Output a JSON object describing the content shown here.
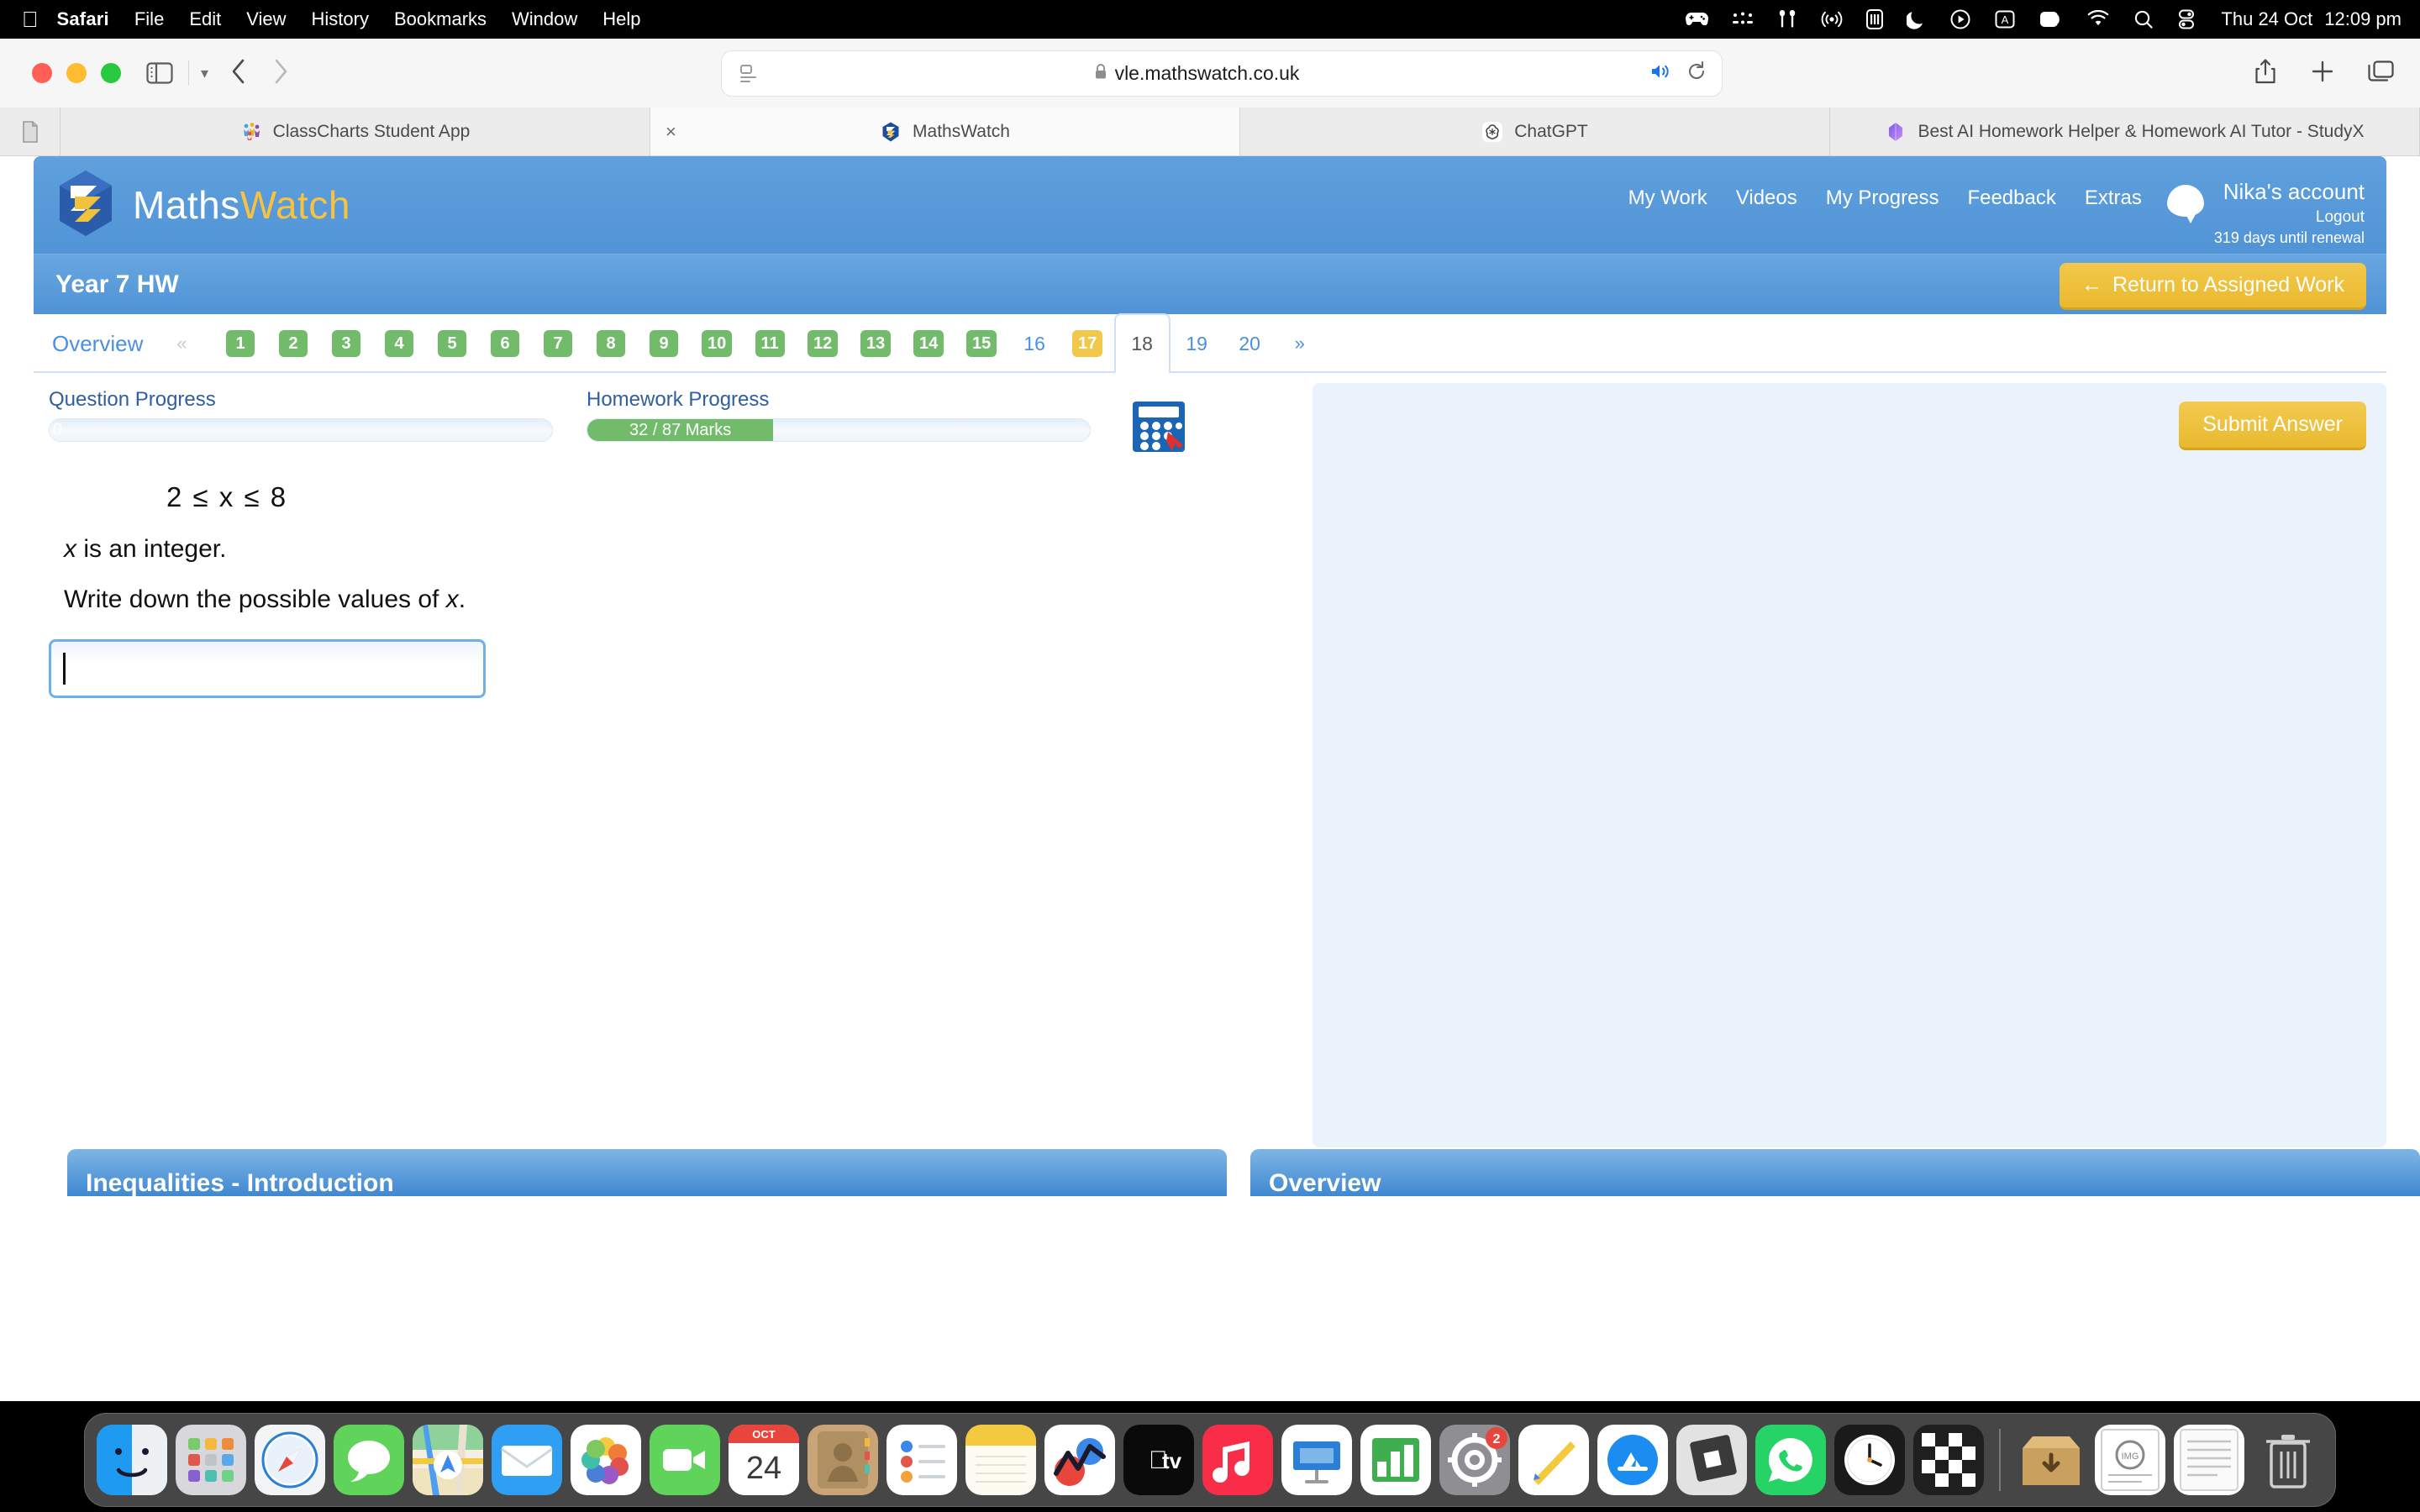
{
  "menubar": {
    "apple_icon": "apple-icon",
    "app_name": "Safari",
    "items": [
      "File",
      "Edit",
      "View",
      "History",
      "Bookmarks",
      "Window",
      "Help"
    ],
    "status_icons": [
      "game-controller-icon",
      "braille-dots-icon",
      "airpods-icon",
      "airplay-audio-icon",
      "battery-module-icon",
      "do-not-disturb-moon-icon",
      "now-playing-icon",
      "keyboard-input-a-icon",
      "screen-mirroring-icon",
      "wifi-icon",
      "spotlight-search-icon",
      "control-center-icon"
    ],
    "date": "Thu 24 Oct",
    "time": "12:09 pm"
  },
  "safari": {
    "toolbar": {
      "sidebar_icon": "sidebar-toggle-icon",
      "tab_overview_chevron": "chevron-down-icon",
      "back_icon": "back-chevron-icon",
      "forward_icon": "forward-chevron-icon",
      "reader_icon": "reader-view-icon",
      "lock_icon": "lock-icon",
      "url": "vle.mathswatch.co.uk",
      "audio_icon": "audio-playing-icon",
      "reload_icon": "reload-icon",
      "share_icon": "share-icon",
      "new_tab_icon": "plus-icon",
      "tab_group_icon": "tab-overview-icon"
    },
    "tabs": [
      {
        "label": "ClassCharts Student App",
        "favicon": "classcharts-icon",
        "active": false
      },
      {
        "label": "MathsWatch",
        "favicon": "mathswatch-icon",
        "active": true,
        "close": "×"
      },
      {
        "label": "ChatGPT",
        "favicon": "chatgpt-icon",
        "active": false
      },
      {
        "label": "Best AI Homework Helper & Homework AI Tutor - StudyX",
        "favicon": "studyx-icon",
        "active": false
      }
    ]
  },
  "site": {
    "brand": {
      "part1": "Maths",
      "part2": "Watch",
      "logo_icon": "mathswatch-logo-icon"
    },
    "nav": [
      "My Work",
      "Videos",
      "My Progress",
      "Feedback",
      "Extras"
    ],
    "account": {
      "avatar_icon": "speech-bubble-avatar-icon",
      "name": "Nika's account",
      "logout": "Logout",
      "renewal": "319 days until renewal"
    },
    "assignment": {
      "title": "Year 7 HW",
      "return_button": "Return to Assigned Work",
      "return_icon": "left-arrow-icon"
    },
    "question_nav": {
      "overview_label": "Overview",
      "prev_icon": "«",
      "next_icon": "»",
      "items": [
        {
          "n": "1",
          "state": "green"
        },
        {
          "n": "2",
          "state": "green"
        },
        {
          "n": "3",
          "state": "green"
        },
        {
          "n": "4",
          "state": "green"
        },
        {
          "n": "5",
          "state": "green"
        },
        {
          "n": "6",
          "state": "green"
        },
        {
          "n": "7",
          "state": "green"
        },
        {
          "n": "8",
          "state": "green"
        },
        {
          "n": "9",
          "state": "green"
        },
        {
          "n": "10",
          "state": "green"
        },
        {
          "n": "11",
          "state": "green"
        },
        {
          "n": "12",
          "state": "green"
        },
        {
          "n": "13",
          "state": "green"
        },
        {
          "n": "14",
          "state": "green"
        },
        {
          "n": "15",
          "state": "green"
        },
        {
          "n": "16",
          "state": "plain"
        },
        {
          "n": "17",
          "state": "amber"
        },
        {
          "n": "18",
          "state": "current"
        },
        {
          "n": "19",
          "state": "plain"
        },
        {
          "n": "20",
          "state": "plain"
        }
      ]
    },
    "progress": {
      "question": {
        "label": "Question Progress",
        "value_text": "0",
        "percent": 0
      },
      "homework": {
        "label": "Homework Progress",
        "value_text": "32 / 87 Marks",
        "percent": 37,
        "marks_earned": 32,
        "marks_total": 87
      }
    },
    "calculator_icon": "calculator-not-allowed-icon",
    "question": {
      "inequality": "2 ≤ x ≤ 8",
      "line1_pre": "x",
      "line1_post": " is an integer.",
      "line2_pre": "Write down the possible values of ",
      "line2_var": "x",
      "line2_post": "."
    },
    "answer": {
      "value": "",
      "placeholder": ""
    },
    "submit_button": "Submit Answer",
    "bottom_panels": [
      {
        "title": "Inequalities - Introduction"
      },
      {
        "title": "Overview"
      }
    ],
    "colors": {
      "brand_blue": "#5b9bd5",
      "accent_yellow": "#f2c84b",
      "correct_green": "#72bb6a",
      "link_blue": "#4a90e2"
    }
  },
  "dock": {
    "items": [
      {
        "name": "finder",
        "running": true
      },
      {
        "name": "launchpad",
        "running": false
      },
      {
        "name": "safari",
        "running": true
      },
      {
        "name": "messages",
        "running": true
      },
      {
        "name": "maps",
        "running": true
      },
      {
        "name": "mail",
        "running": false
      },
      {
        "name": "photos",
        "running": false
      },
      {
        "name": "facetime",
        "running": false
      },
      {
        "name": "calendar",
        "running": false,
        "month": "OCT",
        "day": "24"
      },
      {
        "name": "contacts",
        "running": false
      },
      {
        "name": "reminders",
        "running": true
      },
      {
        "name": "notes",
        "running": true
      },
      {
        "name": "stocks",
        "running": false
      },
      {
        "name": "apple-tv",
        "running": false
      },
      {
        "name": "music",
        "running": false
      },
      {
        "name": "keynote",
        "running": false
      },
      {
        "name": "numbers",
        "running": false
      },
      {
        "name": "settings",
        "running": false,
        "badge": "2"
      },
      {
        "name": "freeform",
        "running": false
      },
      {
        "name": "app-store",
        "running": false
      },
      {
        "name": "roblox",
        "running": false
      },
      {
        "name": "whatsapp",
        "running": false
      },
      {
        "name": "clock",
        "running": false
      },
      {
        "name": "chess",
        "running": false
      },
      {
        "name": "downloads-stack",
        "running": false
      },
      {
        "name": "document-stack",
        "running": false
      },
      {
        "name": "documents-folder",
        "running": false
      },
      {
        "name": "trash",
        "running": false
      }
    ]
  }
}
